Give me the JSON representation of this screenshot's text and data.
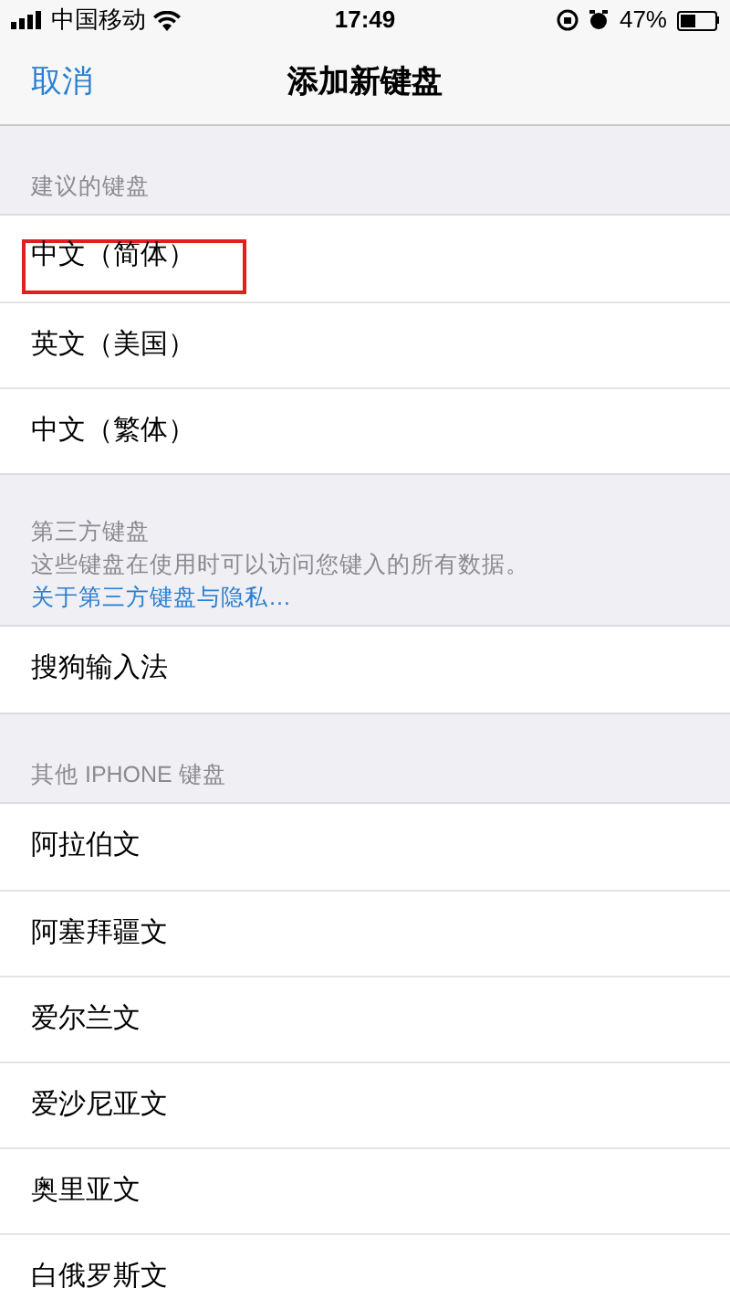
{
  "status_bar": {
    "carrier": "中国移动",
    "time": "17:49",
    "battery": "47%"
  },
  "nav": {
    "cancel": "取消",
    "title": "添加新键盘"
  },
  "sections": [
    {
      "header": "建议的键盘",
      "items": [
        {
          "label": "中文（简体）",
          "highlighted": true
        },
        {
          "label": "英文（美国）",
          "highlighted": false
        },
        {
          "label": "中文（繁体）",
          "highlighted": false
        }
      ]
    },
    {
      "header": "第三方键盘",
      "note": "这些键盘在使用时可以访问您键入的所有数据。",
      "link": "关于第三方键盘与隐私…",
      "items": [
        {
          "label": "搜狗输入法",
          "highlighted": false
        }
      ]
    },
    {
      "header": "其他 IPHONE 键盘",
      "items": [
        {
          "label": "阿拉伯文",
          "highlighted": false
        },
        {
          "label": "阿塞拜疆文",
          "highlighted": false
        },
        {
          "label": "爱尔兰文",
          "highlighted": false
        },
        {
          "label": "爱沙尼亚文",
          "highlighted": false
        },
        {
          "label": "奥里亚文",
          "highlighted": false
        },
        {
          "label": "白俄罗斯文",
          "highlighted": false
        }
      ]
    }
  ]
}
